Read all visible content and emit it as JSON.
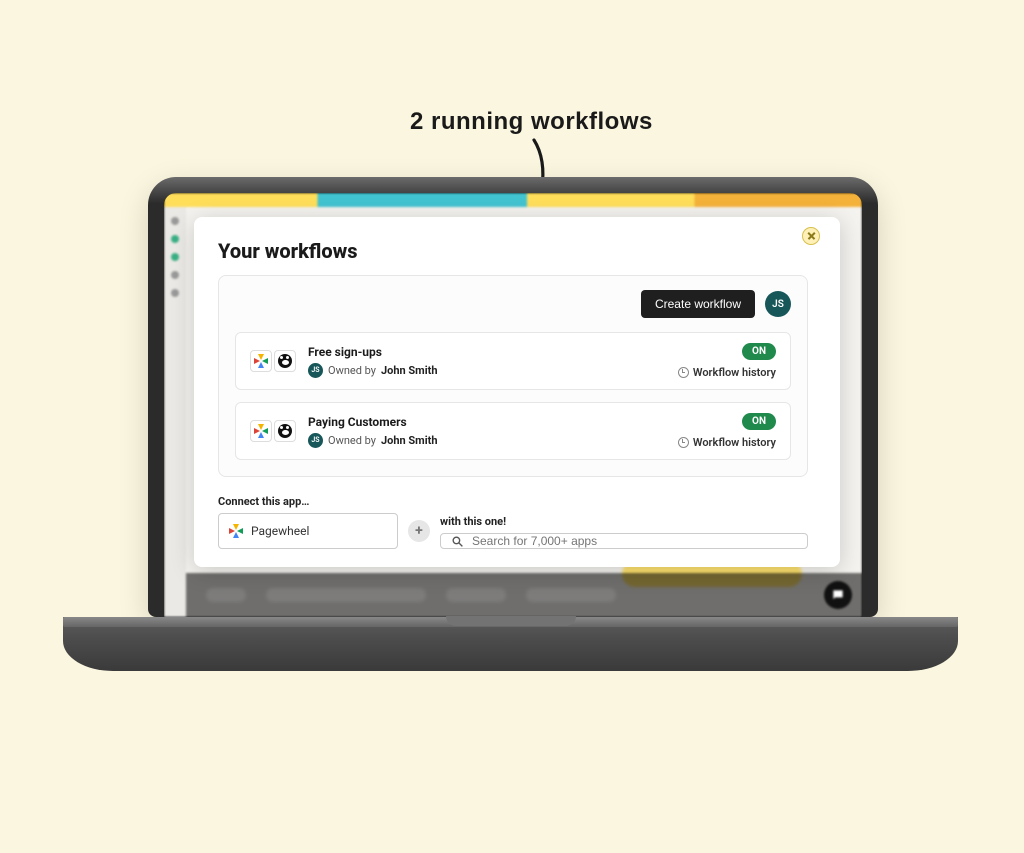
{
  "annotation": {
    "text": "2 running workflows"
  },
  "modal": {
    "title": "Your workflows",
    "create_button": "Create workflow",
    "user_initials": "JS",
    "owner_prefix": "Owned by",
    "history_label": "Workflow history",
    "workflows": [
      {
        "title": "Free sign-ups",
        "owner_name": "John Smith",
        "status": "ON"
      },
      {
        "title": "Paying Customers",
        "owner_name": "John Smith",
        "status": "ON"
      }
    ],
    "connect": {
      "left_label": "Connect this app…",
      "right_label": "with this one!",
      "left_app": "Pagewheel",
      "search_placeholder": "Search for 7,000+ apps"
    }
  }
}
